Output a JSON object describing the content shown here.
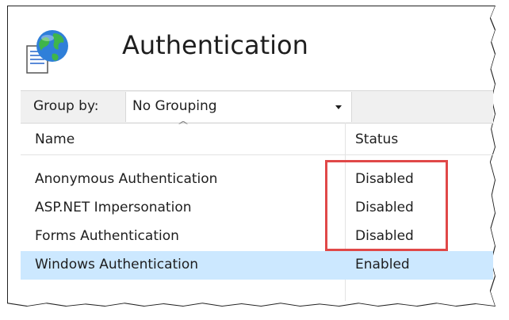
{
  "header": {
    "title": "Authentication",
    "icon": "globe-document-icon"
  },
  "toolbar": {
    "group_by_label": "Group by:",
    "group_by_value": "No Grouping"
  },
  "table": {
    "columns": [
      "Name",
      "Status"
    ],
    "rows": [
      {
        "name": "Anonymous Authentication",
        "status": "Disabled"
      },
      {
        "name": "ASP.NET Impersonation",
        "status": "Disabled"
      },
      {
        "name": "Forms Authentication",
        "status": "Disabled"
      },
      {
        "name": "Windows Authentication",
        "status": "Enabled"
      }
    ],
    "selected_row": 3
  },
  "colors": {
    "selection": "#cce8ff",
    "highlight": "#e04848"
  }
}
